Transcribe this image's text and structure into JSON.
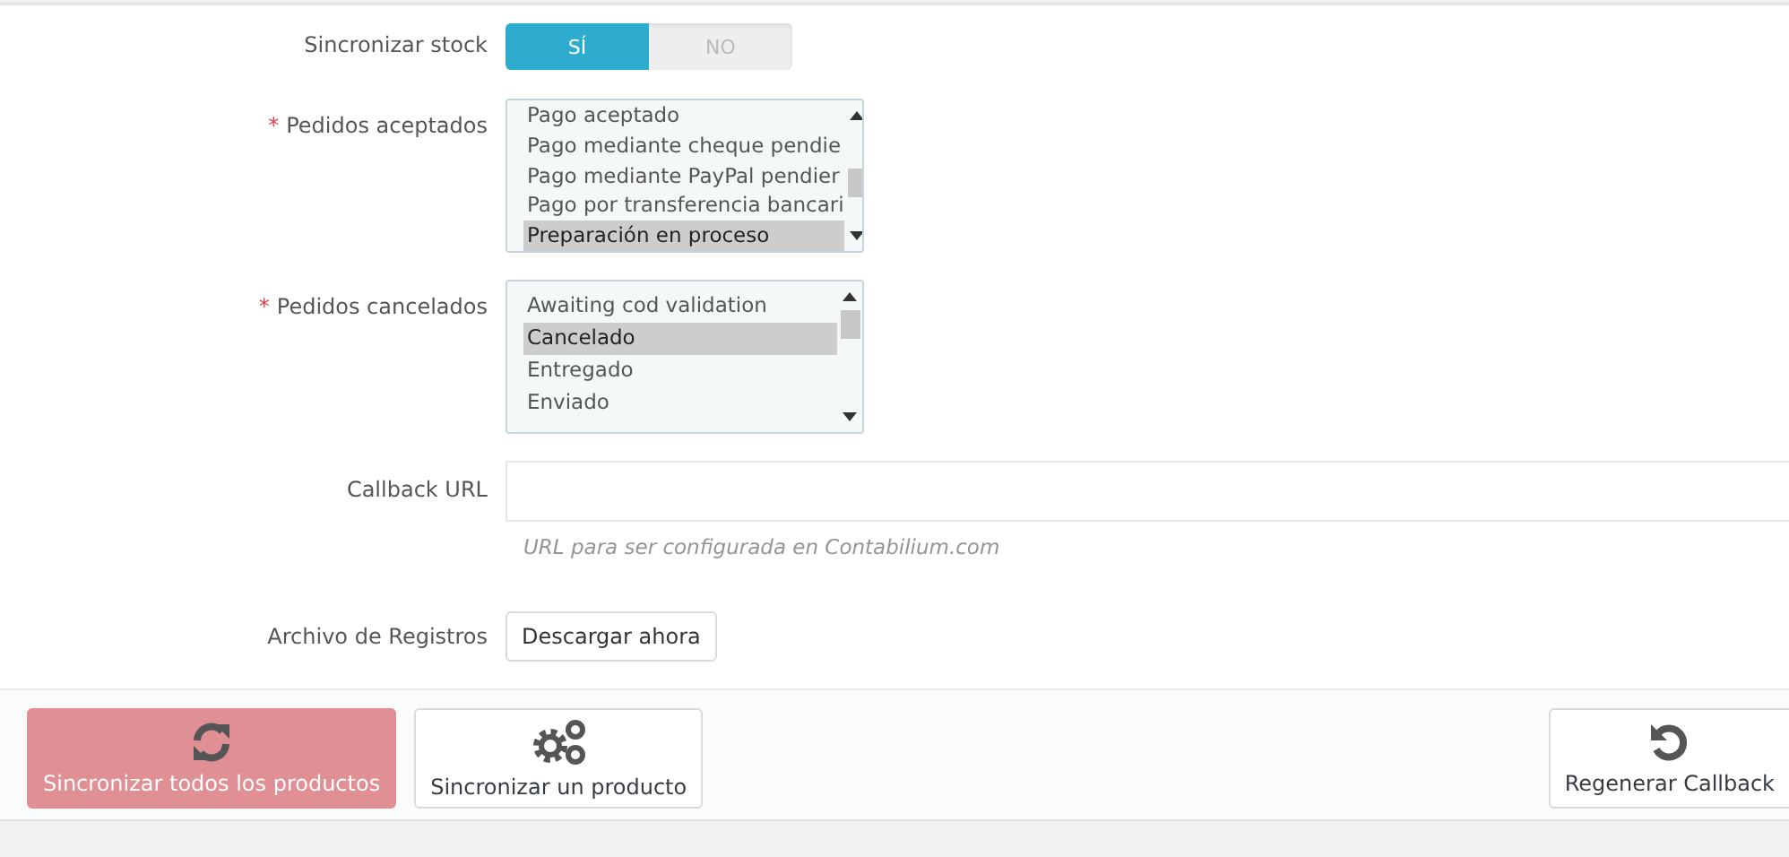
{
  "sync_stock": {
    "label": "Sincronizar stock",
    "options": [
      {
        "label": "SÍ",
        "selected": true
      },
      {
        "label": "NO",
        "selected": false
      }
    ]
  },
  "order_lists": [
    {
      "label": "Pedidos aceptados",
      "required_mark": "*",
      "items": [
        {
          "label": "Pago aceptado",
          "selected": false
        },
        {
          "label": "Pago mediante cheque pendie",
          "selected": false
        },
        {
          "label": "Pago mediante PayPal pendier",
          "selected": false
        },
        {
          "label": "Pago por transferencia bancari",
          "selected": false
        },
        {
          "label": "Preparación en proceso",
          "selected": true
        }
      ]
    },
    {
      "label": "Pedidos cancelados",
      "required_mark": "*",
      "items": [
        {
          "label": "Awaiting cod validation",
          "selected": false
        },
        {
          "label": "Cancelado",
          "selected": true
        },
        {
          "label": "Entregado",
          "selected": false
        },
        {
          "label": "Enviado",
          "selected": false
        }
      ]
    }
  ],
  "callback_url": {
    "label": "Callback URL",
    "help": "URL para ser configurada en Contabilium.com"
  },
  "log_file": {
    "label": "Archivo de Registros",
    "button": "Descargar ahora"
  },
  "footer_buttons": [
    {
      "label": "Sincronizar todos los productos",
      "kind": "refresh",
      "primary": true
    },
    {
      "label": "Sincronizar un producto",
      "kind": "gears",
      "primary": false
    },
    {
      "label": "Regenerar Callback",
      "kind": "undo",
      "primary": false
    }
  ]
}
